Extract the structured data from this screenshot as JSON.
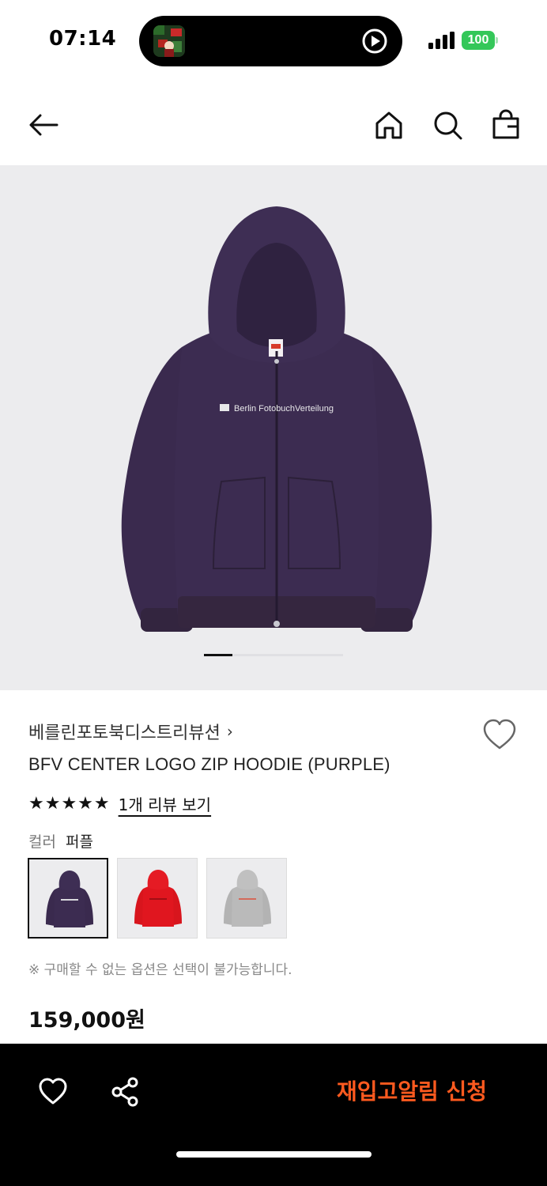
{
  "status": {
    "time": "07:14",
    "battery": "100"
  },
  "colors": {
    "accent": "#ff5a1f",
    "battery": "#34c759",
    "hoodie_purple": "#3a2a4e",
    "hoodie_red": "#d8151d",
    "hoodie_gray": "#b7b7b7"
  },
  "header": {
    "icons": [
      "back-arrow-icon",
      "home-icon",
      "search-icon",
      "shopping-bag-icon"
    ]
  },
  "gallery": {
    "print_text": "Berlin FotobuchVerteilung",
    "current_image": 1
  },
  "product": {
    "brand": "베를린포토북디스트리뷰션",
    "brand_chevron": "›",
    "title": "BFV CENTER LOGO ZIP HOODIE (PURPLE)",
    "stars": "★★★★★",
    "rating": 5,
    "review_link": "1개 리뷰 보기",
    "color_label": "컬러",
    "color_value": "퍼플",
    "swatches": [
      "purple",
      "red",
      "gray"
    ],
    "selected_swatch": "purple",
    "option_note": "※ 구매할 수 없는 옵션은 선택이 불가능합니다.",
    "price": "159,000원"
  },
  "bottom_bar": {
    "restock_label": "재입고알림 신청"
  }
}
